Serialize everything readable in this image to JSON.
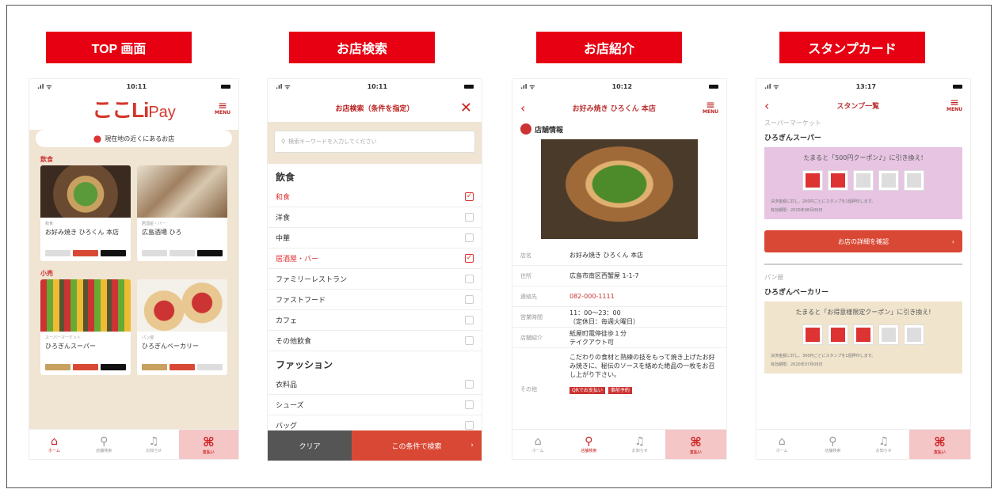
{
  "labels": [
    "TOP 画面",
    "お店検索",
    "お店紹介",
    "スタンプカード"
  ],
  "p1": {
    "time": "10:11",
    "logo": "ここLi",
    "logo_pay": "Pay",
    "menu": "MENU",
    "nearby": "現在地の近くにあるお店",
    "cat_food": "飲食",
    "cat_retail": "小売",
    "food_cards": [
      {
        "sub": "和食",
        "name": "お好み焼き ひろくん 本店"
      },
      {
        "sub": "居酒屋・バー",
        "name": "広島酒場 ひろ"
      }
    ],
    "retail_cards": [
      {
        "sub": "スーパーマーケット",
        "name": "ひろぎんスーパー"
      },
      {
        "sub": "パン屋",
        "name": "ひろぎんベーカリー"
      }
    ]
  },
  "tabs": {
    "home": "ホーム",
    "search": "店舗検索",
    "notice": "お知らせ",
    "pay": "支払い"
  },
  "p2": {
    "time": "10:11",
    "title": "お店検索（条件を指定）",
    "placeholder": "検索キーワードを入力してください",
    "group1": "飲食",
    "items1": [
      {
        "label": "和食",
        "checked": true
      },
      {
        "label": "洋食",
        "checked": false
      },
      {
        "label": "中華",
        "checked": false
      },
      {
        "label": "居酒屋・バー",
        "checked": true
      },
      {
        "label": "ファミリーレストラン",
        "checked": false
      },
      {
        "label": "ファストフード",
        "checked": false
      },
      {
        "label": "カフェ",
        "checked": false
      },
      {
        "label": "その他飲食",
        "checked": false
      }
    ],
    "group2": "ファッション",
    "items2": [
      {
        "label": "衣料品",
        "checked": false
      },
      {
        "label": "シューズ",
        "checked": false
      },
      {
        "label": "バッグ",
        "checked": false
      }
    ],
    "clear": "クリア",
    "search": "この条件で検索"
  },
  "p3": {
    "time": "10:12",
    "title": "お好み焼き ひろくん 本店",
    "section": "店舗情報",
    "rows": [
      {
        "k": "店名",
        "v": "お好み焼き ひろくん 本店"
      },
      {
        "k": "住所",
        "v": "広島市南区西蟹屋 1-1-7"
      },
      {
        "k": "連絡先",
        "v": "082-000-1111"
      },
      {
        "k": "営業時間",
        "v": "11：00〜23：00",
        "v2": "（定休日：毎週火曜日）"
      },
      {
        "k": "店舗紹介",
        "v": "紙屋町電停徒歩１分",
        "v2": "テイクアウト可"
      }
    ],
    "intro": "こだわりの食材と熟練の技をもって焼き上げたお好み焼きに、秘伝のソースを絡めた絶品の一枚をお召し上がり下さい。",
    "other_k": "その他",
    "badges": [
      "QRでお支払い",
      "事前予約"
    ]
  },
  "p4": {
    "time": "13:17",
    "title": "スタンプ一覧",
    "sect1": "スーパーマーケット",
    "shop1": "ひろぎんスーパー",
    "msg1": "たまると「500円クーポン♪」に引き換え!",
    "fine1": "決済金額に対し、200円ごとにスタンプを1個押印します。",
    "exp1": "有効期限：2020年08月06日",
    "detail": "お店の詳細を確認",
    "sect2": "パン屋",
    "shop2": "ひろぎんベーカリー",
    "msg2": "たまると「お得意様限定クーポン」に引き換え!",
    "fine2": "決済金額に対し、300円ごとにスタンプを1個押印します。",
    "exp2": "有効期限：2020年07月09日"
  }
}
